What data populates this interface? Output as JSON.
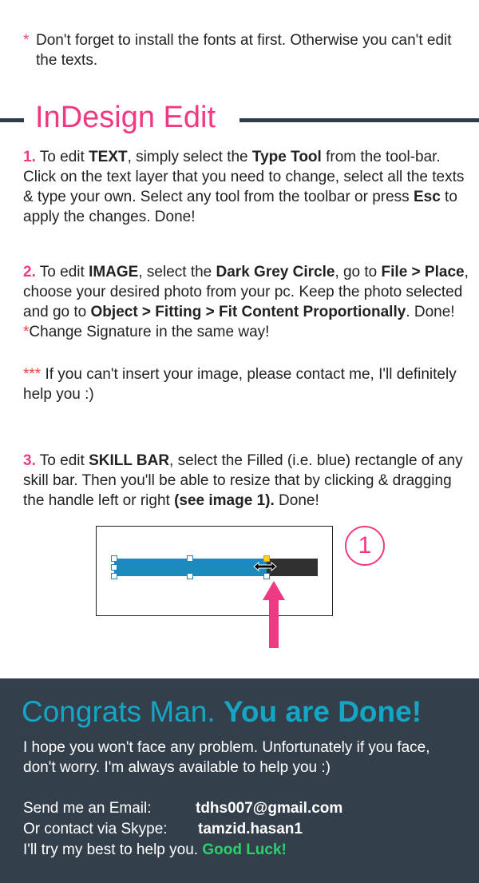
{
  "note": {
    "star": "*",
    "text": "Don't forget to install the fonts at first. Otherwise you can't edit the texts."
  },
  "heading": "InDesign Edit",
  "step1": {
    "num": "1.",
    "t1": " To edit ",
    "b1": "TEXT",
    "t2": ", simply select the ",
    "b2": "Type Tool",
    "t3": " from the tool-bar. Click on the text layer that you need to change, select all the texts & type your own. Select any tool from the toolbar or press ",
    "b3": "Esc",
    "t4": " to apply the changes. Done!"
  },
  "step2": {
    "num": "2.",
    "t1": " To edit ",
    "b1": "IMAGE",
    "t2": ", select the ",
    "b2": "Dark Grey Circle",
    "t3": ", go to ",
    "b3": "File > Place",
    "t4": ", choose your desired photo from your pc. Keep the photo selected and go to ",
    "b4": "Object > Fitting > Fit Content Proportionally",
    "t5": ". Done! ",
    "star": "*",
    "t6": "Change Signature in the same way!"
  },
  "note2": {
    "stars": "***",
    "text": " If you can't insert your image, please contact me, I'll definitely help you :)"
  },
  "step3": {
    "num": "3.",
    "t1": " To edit ",
    "b1": "SKILL BAR",
    "t2": ", select the Filled (i.e. blue) rectangle of any skill bar. Then you'll be able to resize that by clicking & dragging the handle left or right ",
    "b2": "(see image 1).",
    "t3": " Done!"
  },
  "illustration": {
    "badge": "1",
    "skill_fill_fraction": 0.75
  },
  "footer": {
    "congrats_light": "Congrats Man. ",
    "congrats_bold": "You are Done!",
    "text": "I hope you won't face any problem. Unfortunately if you face, don't worry. I'm always available to help you :)",
    "email_label": "Send me an Email:",
    "email": "tdhs007@gmail.com",
    "skype_label": "Or contact via Skype:",
    "skype": "tamzid.hasan1",
    "closing": "I'll try my best to help you. ",
    "good_luck": "Good Luck!"
  },
  "colors": {
    "accent_pink": "#ef3a83",
    "footer_bg": "#333f4b",
    "cyan": "#15a6c6",
    "green": "#2ed06e",
    "bar_blue": "#1b8bbe",
    "bar_dark": "#303030"
  }
}
